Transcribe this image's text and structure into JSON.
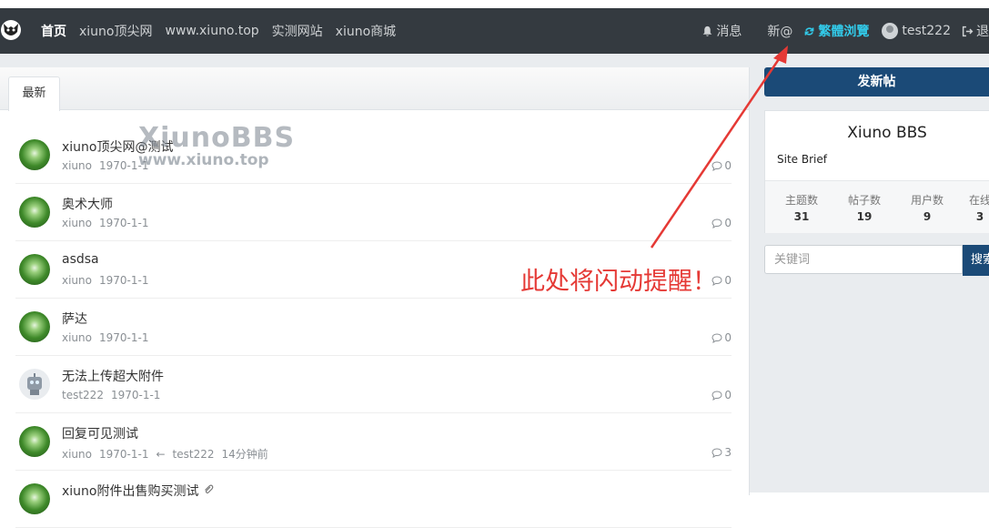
{
  "nav": {
    "items": [
      {
        "label": "首页",
        "active": true
      },
      {
        "label": "xiuno顶尖网"
      },
      {
        "label": "www.xiuno.top"
      },
      {
        "label": "实测网站"
      },
      {
        "label": "xiuno商城"
      }
    ],
    "messages": "消息",
    "new_at": "新@",
    "traditional": "繁體浏覽",
    "username": "test222",
    "logout": "退"
  },
  "tabs": [
    {
      "label": "最新"
    }
  ],
  "threads": [
    {
      "title": "xiuno顶尖网@测试",
      "author": "xiuno",
      "date": "1970-1-1",
      "replies": "0",
      "avatar": "green"
    },
    {
      "title": "奥术大师",
      "author": "xiuno",
      "date": "1970-1-1",
      "replies": "0",
      "avatar": "green"
    },
    {
      "title": "asdsa",
      "author": "xiuno",
      "date": "1970-1-1",
      "replies": "0",
      "avatar": "green"
    },
    {
      "title": "萨达",
      "author": "xiuno",
      "date": "1970-1-1",
      "replies": "0",
      "avatar": "green"
    },
    {
      "title": "无法上传超大附件",
      "author": "test222",
      "date": "1970-1-1",
      "replies": "0",
      "avatar": "robot"
    },
    {
      "title": "回复可见测试",
      "author": "xiuno",
      "date": "1970-1-1",
      "last_sep": "←",
      "last_user": "test222",
      "last_time": "14分钟前",
      "replies": "3",
      "avatar": "green"
    },
    {
      "title": "xiuno附件出售购买测试",
      "avatar": "green",
      "has_attachment": true
    }
  ],
  "watermark": {
    "line1": "XiunoBBS",
    "line2": "www.xiuno.top"
  },
  "sidebar": {
    "new_post_button": "发新帖",
    "site_name": "Xiuno BBS",
    "site_brief": "Site Brief",
    "stats": [
      {
        "label": "主题数",
        "value": "31"
      },
      {
        "label": "帖子数",
        "value": "19"
      },
      {
        "label": "用户数",
        "value": "9"
      },
      {
        "label": "在线",
        "value": "3"
      }
    ],
    "search_placeholder": "关键词",
    "search_button": "搜索"
  },
  "annotation": "此处将闪动提醒！",
  "colors": {
    "navbar": "#343a40",
    "accent_cyan": "#32c9e8",
    "primary": "#1b4a77",
    "annotation_red": "#e53935"
  }
}
